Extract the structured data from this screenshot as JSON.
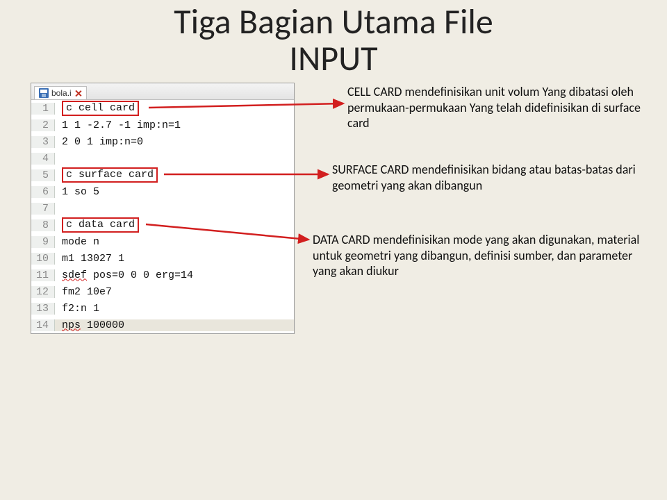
{
  "title_line1": "Tiga Bagian Utama File",
  "title_line2": "INPUT",
  "tab": {
    "filename": "bola.i"
  },
  "lines": {
    "l1": "c cell card",
    "l2": "1 1 -2.7 -1 imp:n=1",
    "l3": "2 0 1 imp:n=0",
    "l4": "",
    "l5": "c surface card",
    "l6": "1 so 5",
    "l7": "",
    "l8": "c data card",
    "l9": "mode n",
    "l10": "m1 13027 1",
    "l11_a": "sdef",
    "l11_b": " pos=0 0 0 erg=14",
    "l12": "fm2 10e7",
    "l13": "f2:n 1",
    "l14_a": "nps",
    "l14_b": " 100000"
  },
  "annotations": {
    "cell": "CELL CARD mendefinisikan unit volum Yang dibatasi oleh permukaan-permukaan Yang telah didefinisikan di surface card",
    "surface": "SURFACE CARD mendefinisikan bidang atau batas-batas dari geometri yang akan dibangun",
    "data": "DATA CARD mendefinisikan mode yang akan digunakan, material untuk geometri yang dibangun, definisi sumber, dan parameter yang akan diukur"
  }
}
